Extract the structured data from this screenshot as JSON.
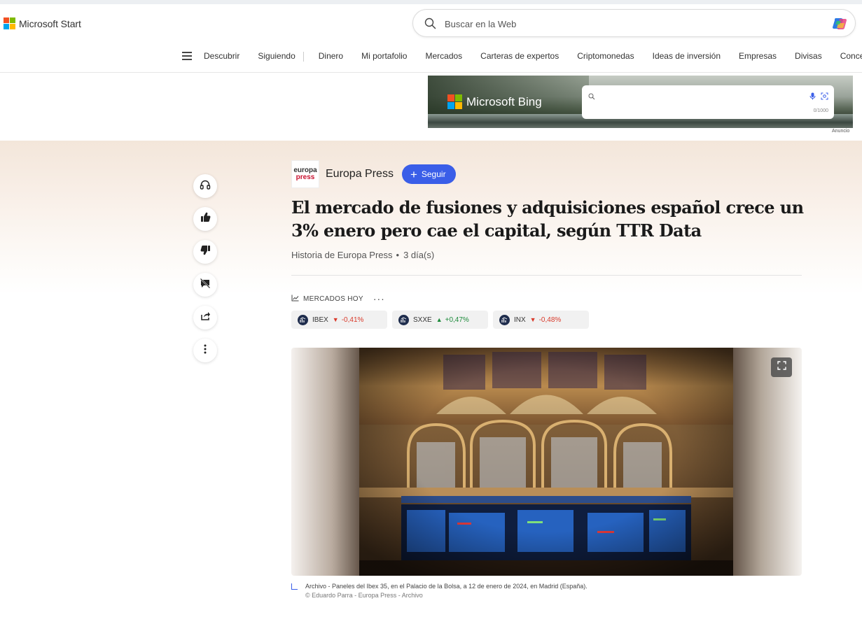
{
  "brand": {
    "name": "Microsoft Start",
    "colors": [
      "#f25022",
      "#7fba00",
      "#00a4ef",
      "#ffb900"
    ]
  },
  "search": {
    "placeholder": "Buscar en la Web"
  },
  "nav": {
    "items": [
      "Descubrir",
      "Siguiendo",
      "Dinero",
      "Mi portafolio",
      "Mercados",
      "Carteras de expertos",
      "Criptomonedas",
      "Ideas de inversión",
      "Empresas",
      "Divisas",
      "Conceptos"
    ]
  },
  "ad": {
    "brand": "Microsoft Bing",
    "counter": "0/1000",
    "label": "Anuncio"
  },
  "sidebar_actions": [
    "headphones-icon",
    "thumbs-up-icon",
    "thumbs-down-icon",
    "comments-off-icon",
    "share-icon",
    "more-vertical-icon"
  ],
  "article": {
    "publisher": {
      "logo_line1": "europa",
      "logo_line2": "press",
      "name": "Europa Press",
      "follow_label": "Seguir"
    },
    "headline": "El mercado de fusiones y adquisiciones español crece un 3% enero pero cae el capital, según TTR Data",
    "byline": "Historia de Europa Press",
    "age": "3 día(s)",
    "markets_label": "MERCADOS HOY",
    "tickers": [
      {
        "symbol": "IBEX",
        "direction": "down",
        "change": "-0,41%"
      },
      {
        "symbol": "SXXE",
        "direction": "up",
        "change": "+0,47%"
      },
      {
        "symbol": "INX",
        "direction": "down",
        "change": "-0,48%"
      }
    ],
    "image_caption": "Archivo - Paneles del Ibex 35, en el Palacio de la Bolsa, a 12 de enero de 2024, en Madrid (España).",
    "image_credit": "© Eduardo Parra - Europa Press - Archivo"
  },
  "colors": {
    "accent": "#3a5ee8",
    "negative": "#d93a2b",
    "positive": "#1c8a3a"
  }
}
